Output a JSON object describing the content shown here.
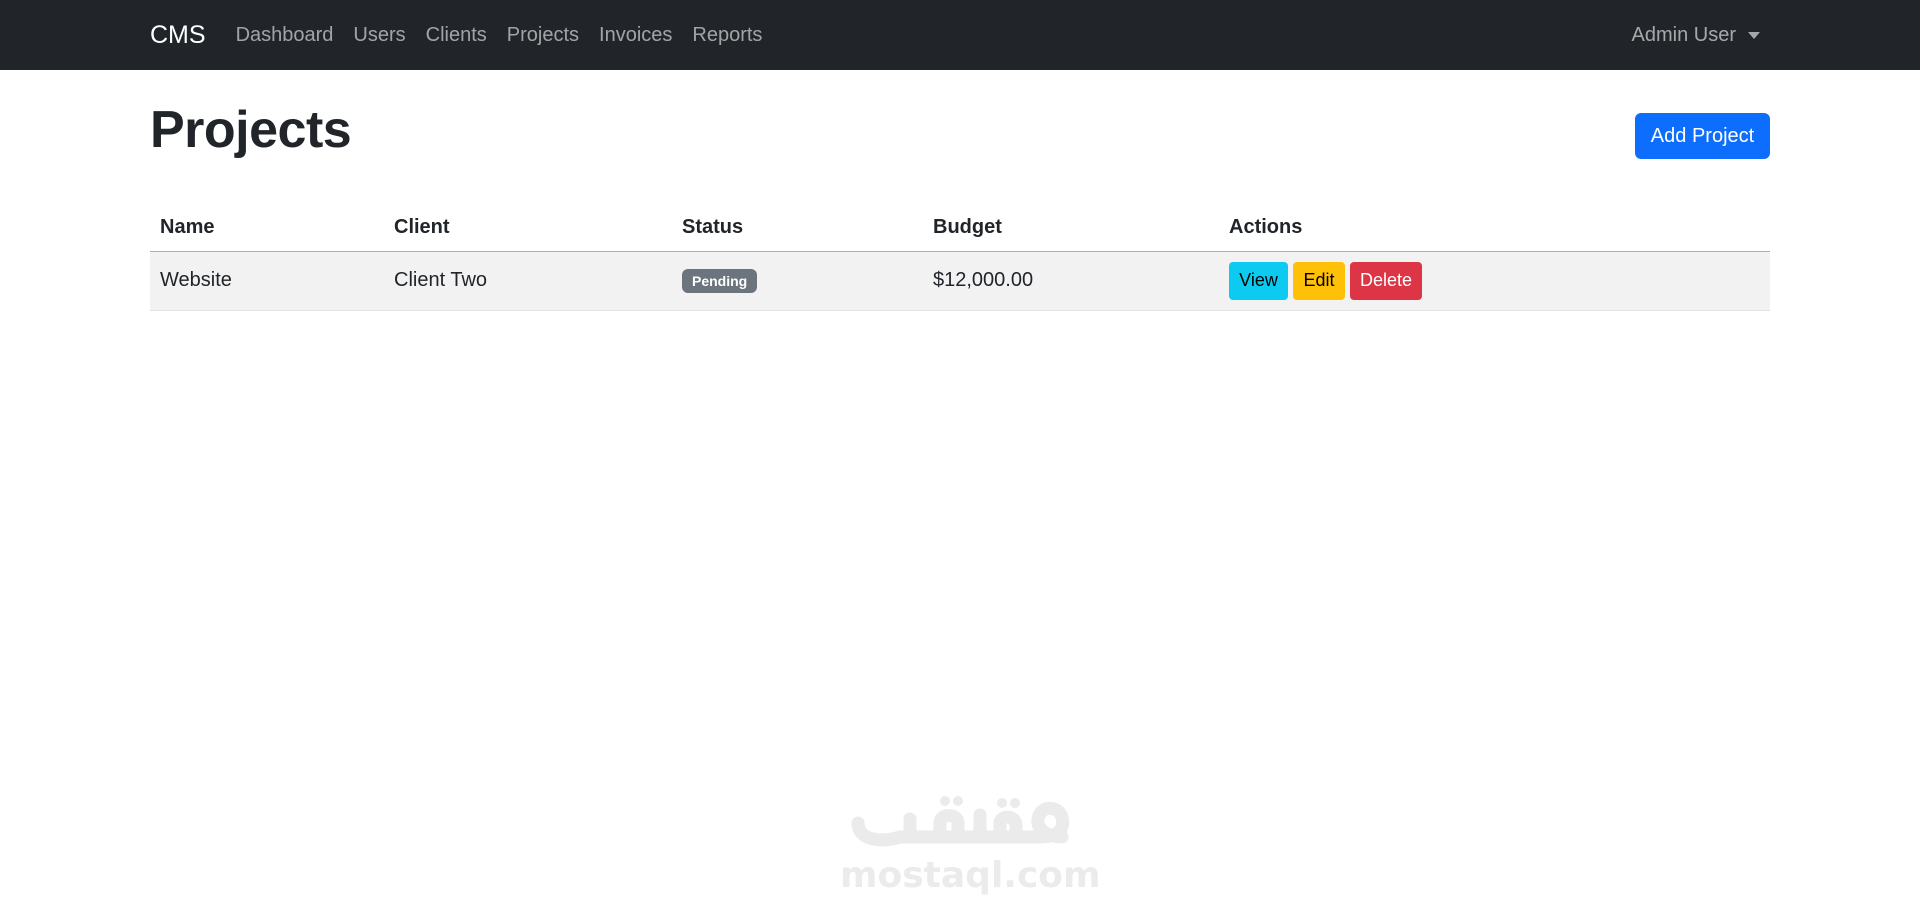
{
  "navbar": {
    "brand": "CMS",
    "links": [
      "Dashboard",
      "Users",
      "Clients",
      "Projects",
      "Invoices",
      "Reports"
    ],
    "user": "Admin User"
  },
  "page": {
    "title": "Projects",
    "add_button": "Add Project"
  },
  "table": {
    "headers": [
      "Name",
      "Client",
      "Status",
      "Budget",
      "Actions"
    ],
    "rows": [
      {
        "name": "Website",
        "client": "Client Two",
        "status": "Pending",
        "budget": "$12,000.00",
        "actions": [
          "View",
          "Edit",
          "Delete"
        ]
      }
    ]
  },
  "watermark": {
    "logo_text": "مستقل",
    "domain": "mostaql.com"
  },
  "colors": {
    "navbar": "#212529",
    "primary": "#0d6efd",
    "info": "#0dcaf0",
    "warning": "#ffc107",
    "danger": "#dc3545",
    "badge": "#6c757d"
  }
}
